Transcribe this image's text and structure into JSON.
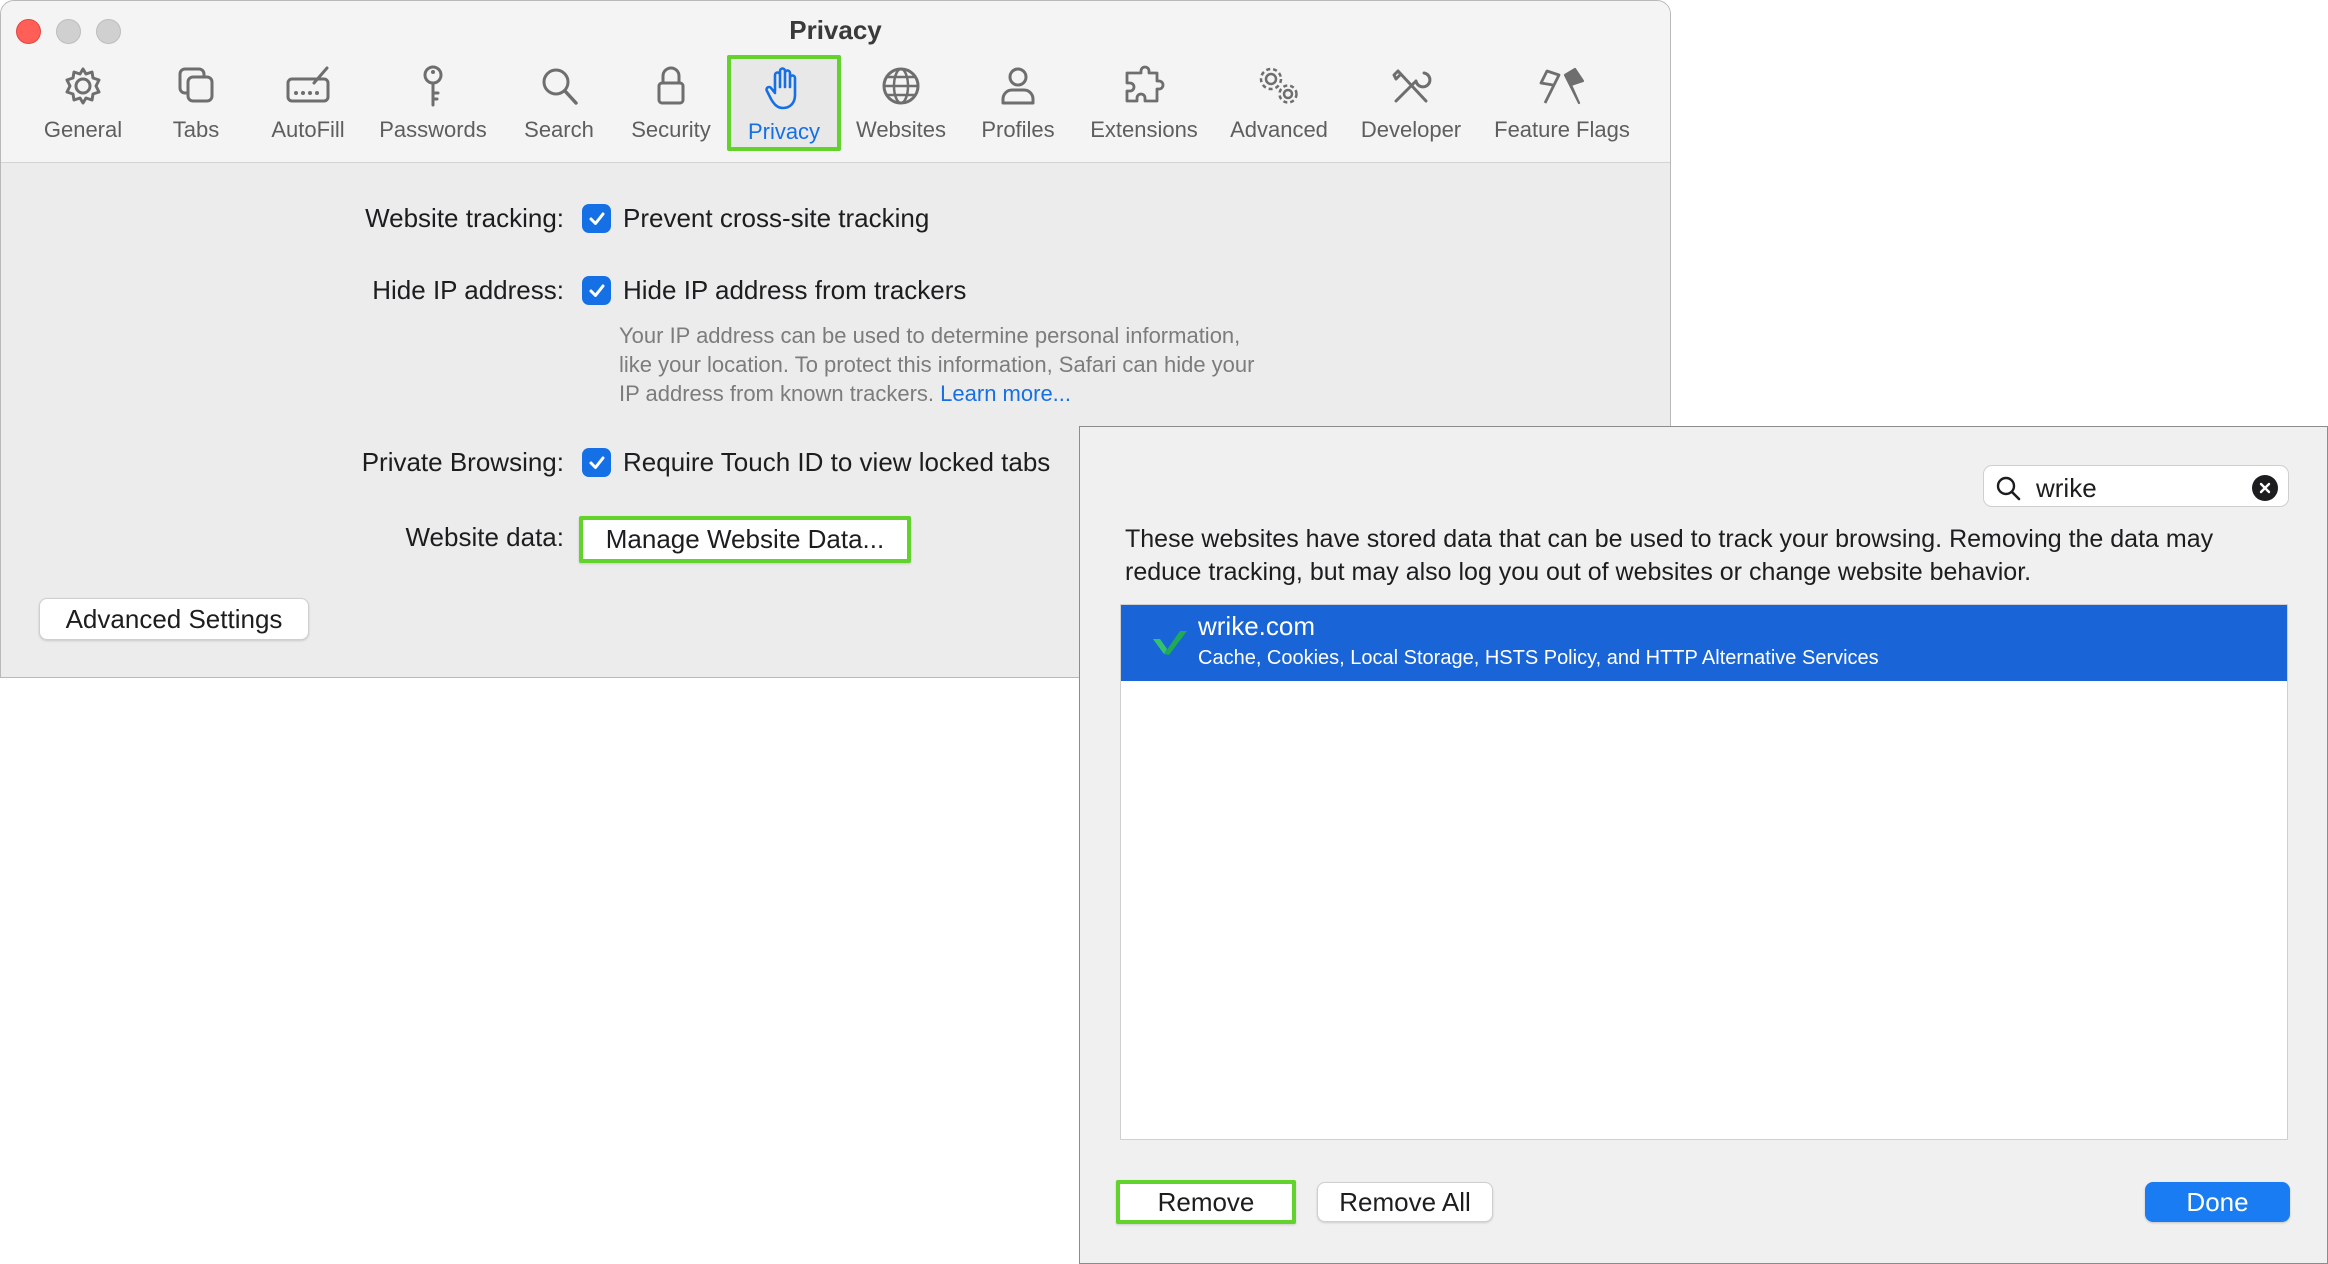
{
  "window": {
    "title": "Privacy"
  },
  "toolbar": {
    "items": [
      {
        "label": "General",
        "icon": "gear-icon"
      },
      {
        "label": "Tabs",
        "icon": "tabs-icon"
      },
      {
        "label": "AutoFill",
        "icon": "autofill-icon"
      },
      {
        "label": "Passwords",
        "icon": "key-icon"
      },
      {
        "label": "Search",
        "icon": "search-icon"
      },
      {
        "label": "Security",
        "icon": "lock-icon"
      },
      {
        "label": "Privacy",
        "icon": "hand-icon",
        "active": true
      },
      {
        "label": "Websites",
        "icon": "globe-icon"
      },
      {
        "label": "Profiles",
        "icon": "person-icon"
      },
      {
        "label": "Extensions",
        "icon": "puzzle-icon"
      },
      {
        "label": "Advanced",
        "icon": "gears-icon"
      },
      {
        "label": "Developer",
        "icon": "tools-icon"
      },
      {
        "label": "Feature Flags",
        "icon": "flags-icon"
      }
    ]
  },
  "privacy": {
    "tracking_label": "Website tracking:",
    "tracking_check": "Prevent cross-site tracking",
    "ip_label": "Hide IP address:",
    "ip_check": "Hide IP address from trackers",
    "ip_desc_line1": "Your IP address can be used to determine personal information,",
    "ip_desc_line2": "like your location. To protect this information, Safari can hide your",
    "ip_desc_line3": "IP address from known trackers.",
    "learn_more": "Learn more...",
    "private_label": "Private Browsing:",
    "private_check": "Require Touch ID to view locked tabs",
    "data_label": "Website data:",
    "manage_button": "Manage Website Data...",
    "advanced_button": "Advanced Settings"
  },
  "sheet": {
    "search_value": "wrike",
    "explanation": "These websites have stored data that can be used to track your browsing. Removing the data may reduce tracking, but may also log you out of websites or change website behavior.",
    "sites": [
      {
        "domain": "wrike.com",
        "details": "Cache, Cookies, Local Storage, HSTS Policy, and HTTP Alternative Services"
      }
    ],
    "remove_button": "Remove",
    "remove_all_button": "Remove All",
    "done_button": "Done"
  },
  "colors": {
    "accent": "#1670e5",
    "selection": "#1965d8",
    "highlight": "#62d22c",
    "close": "#ff5f57"
  }
}
